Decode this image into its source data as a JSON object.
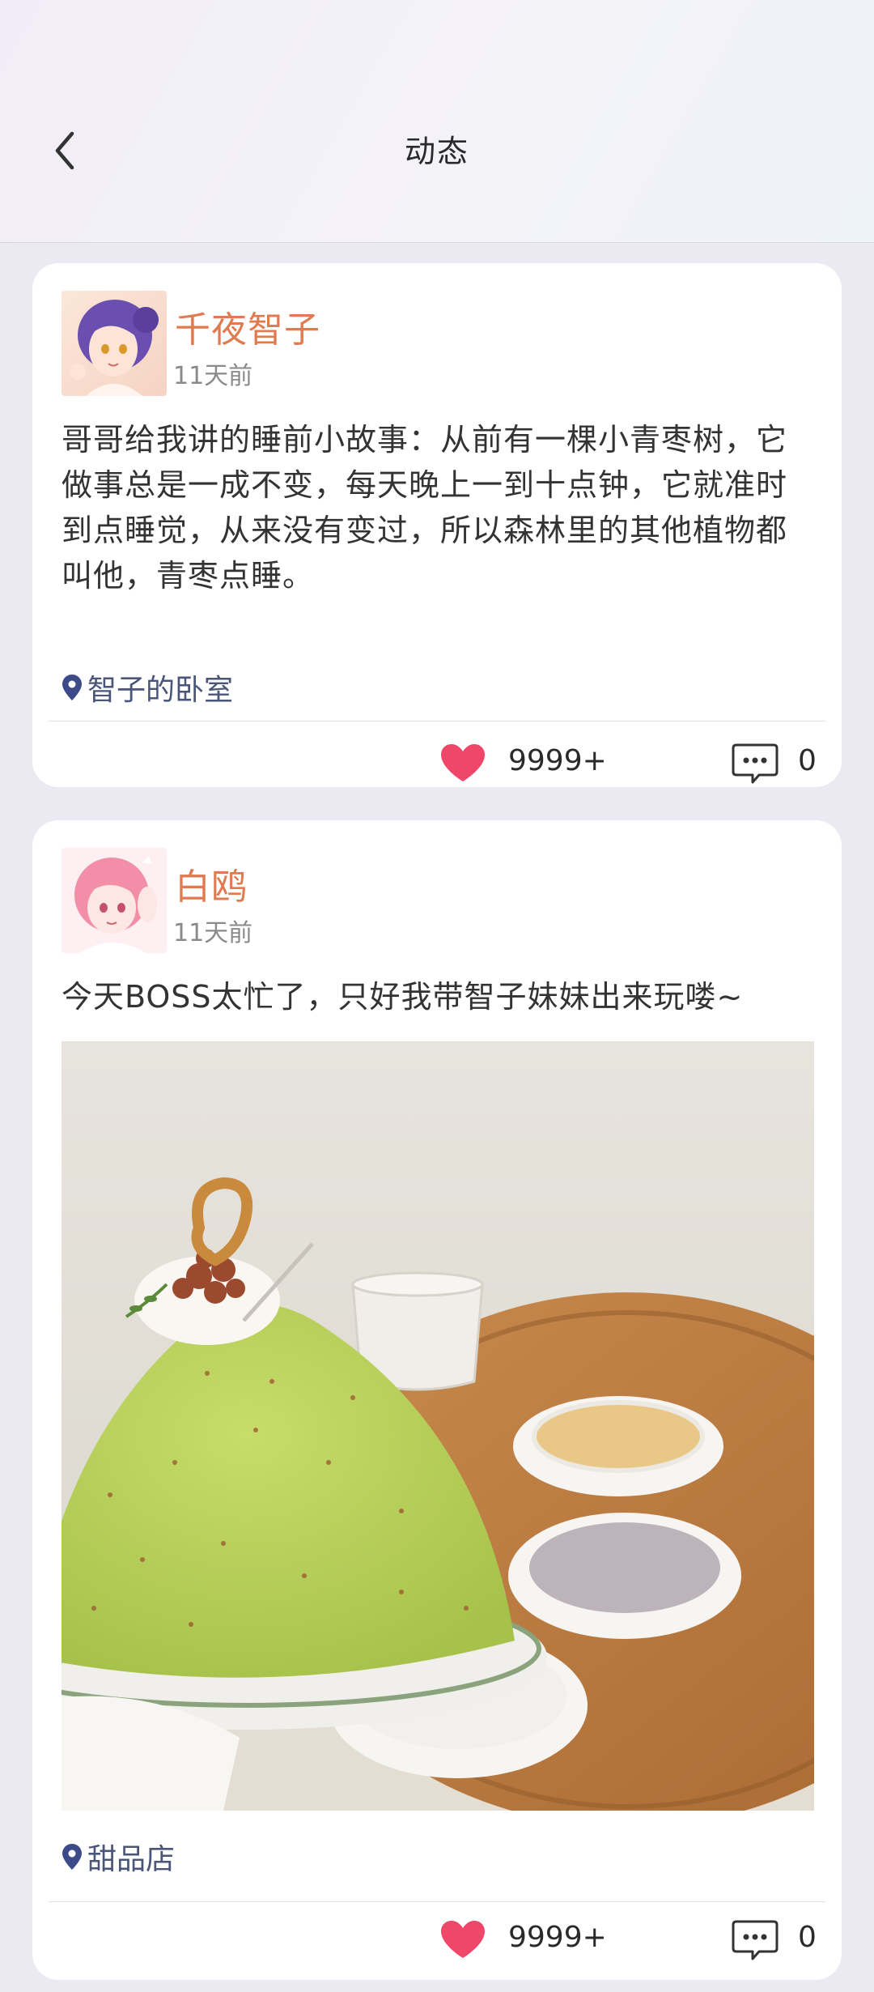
{
  "header": {
    "title": "动态",
    "back_icon": "chevron-left-icon"
  },
  "colors": {
    "author": "#e07a4f",
    "like": "#f0466a",
    "location": "#3d4a8a"
  },
  "posts": [
    {
      "author": "千夜智子",
      "time": "11天前",
      "text": "哥哥给我讲的睡前小故事：从前有一棵小青枣树，它做事总是一成不变，每天晚上一到十点钟，它就准时到点睡觉，从来没有变过，所以森林里的其他植物都叫他，青枣点睡。",
      "location": "智子的卧室",
      "likes": "9999+",
      "comments": "0"
    },
    {
      "author": "白鸥",
      "time": "11天前",
      "text": "今天BOSS太忙了，只好我带智子妹妹出来玩喽~",
      "location": "甜品店",
      "likes": "9999+",
      "comments": "0"
    }
  ]
}
